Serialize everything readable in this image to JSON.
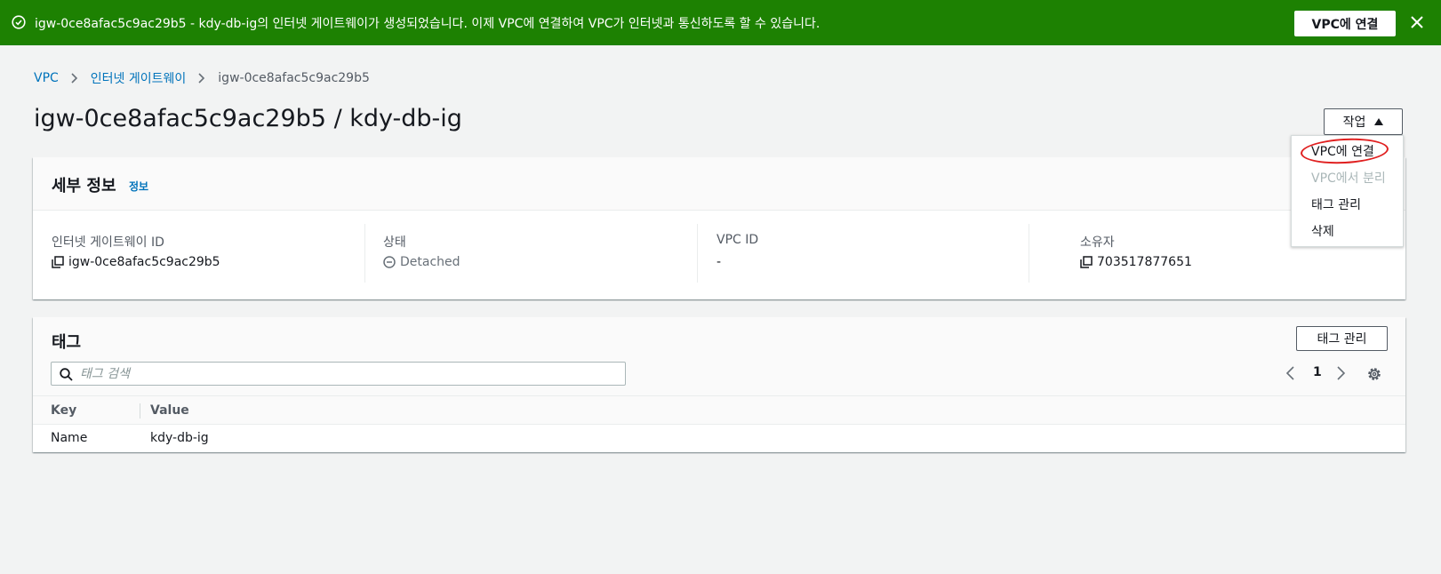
{
  "flash": {
    "message": "igw-0ce8afac5c9ac29b5 - kdy-db-ig의 인터넷 게이트웨이가 생성되었습니다. 이제 VPC에 연결하여 VPC가 인터넷과 통신하도록 할 수 있습니다.",
    "action_label": "VPC에 연결",
    "color": "#1d8102"
  },
  "breadcrumb": {
    "items": [
      "VPC",
      "인터넷 게이트웨이"
    ],
    "current": "igw-0ce8afac5c9ac29b5"
  },
  "page_title": "igw-0ce8afac5c9ac29b5 / kdy-db-ig",
  "actions": {
    "label": "작업",
    "menu": [
      {
        "label": "VPC에 연결",
        "disabled": false
      },
      {
        "label": "VPC에서 분리",
        "disabled": true
      },
      {
        "label": "태그 관리",
        "disabled": false
      },
      {
        "label": "삭제",
        "disabled": false
      }
    ]
  },
  "details": {
    "title": "세부 정보",
    "info_link": "정보",
    "fields": [
      {
        "label": "인터넷 게이트웨이 ID",
        "value": "igw-0ce8afac5c9ac29b5",
        "icon": "copy-icon"
      },
      {
        "label": "상태",
        "value": "Detached",
        "icon": "status-detached-icon"
      },
      {
        "label": "VPC ID",
        "value": "-"
      },
      {
        "label": "소유자",
        "value": "703517877651",
        "icon": "copy-icon"
      }
    ]
  },
  "tags": {
    "title": "태그",
    "manage_label": "태그 관리",
    "search_placeholder": "태그 검색",
    "page": "1",
    "columns": [
      "Key",
      "Value"
    ],
    "rows": [
      {
        "key": "Name",
        "value": "kdy-db-ig"
      }
    ]
  },
  "colors": {
    "link": "#0073bb",
    "annotation_circle": "#e02020"
  }
}
